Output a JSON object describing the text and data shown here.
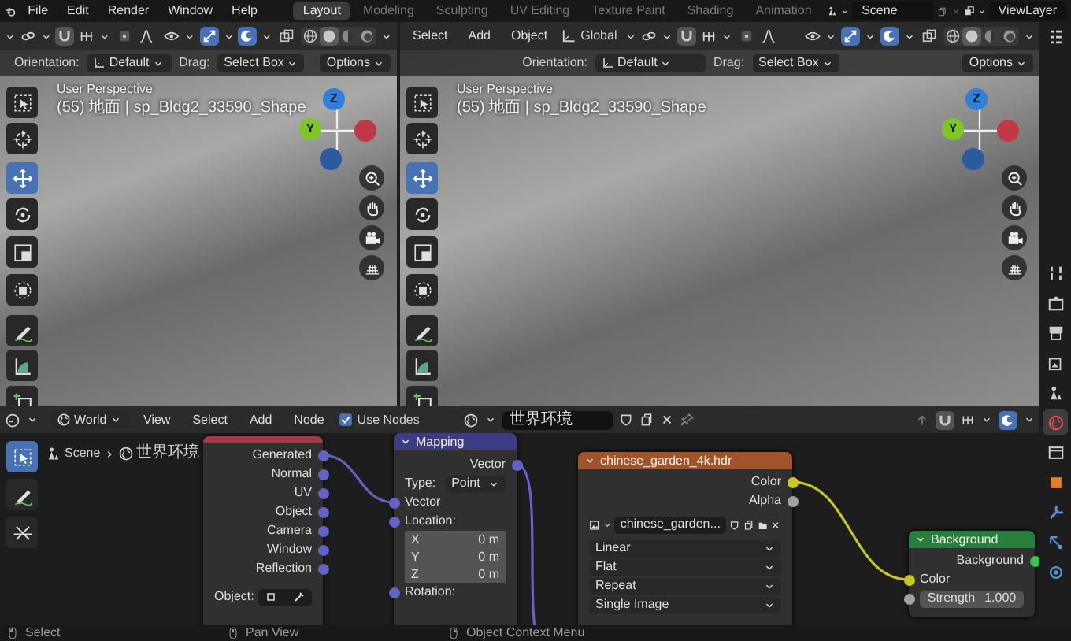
{
  "topbar": {
    "menus": [
      "File",
      "Edit",
      "Render",
      "Window",
      "Help"
    ],
    "workspaces": [
      {
        "label": "Layout",
        "selected": true
      },
      {
        "label": "Modeling",
        "selected": false
      },
      {
        "label": "Sculpting",
        "selected": false
      },
      {
        "label": "UV Editing",
        "selected": false
      },
      {
        "label": "Texture Paint",
        "selected": false
      },
      {
        "label": "Shading",
        "selected": false
      },
      {
        "label": "Animation",
        "selected": false
      }
    ],
    "scene": "Scene",
    "view_layer": "ViewLayer"
  },
  "viewports": [
    {
      "toggles": [
        {
          "kind": "snap",
          "on": false
        },
        {
          "kind": "proportional",
          "on": false
        },
        {
          "kind": "gizmo",
          "on": true
        },
        {
          "kind": "overlay",
          "on": true
        },
        {
          "kind": "xray",
          "on": false
        }
      ],
      "shading": [
        {
          "kind": "wireframe",
          "selected": false
        },
        {
          "kind": "solid",
          "selected": true
        },
        {
          "kind": "material",
          "selected": false
        },
        {
          "kind": "rendered",
          "selected": false
        }
      ],
      "tool_settings": {
        "orientation_label": "Orientation:",
        "orientation": "Default",
        "drag_label": "Drag:",
        "drag": "Select Box",
        "options": "Options"
      },
      "overlay_text": [
        "User Perspective",
        "(55) 地面 | sp_Bldg2_33590_Shape"
      ],
      "axes": [
        "Z",
        "Y"
      ],
      "tools": [
        {
          "kind": "select_box",
          "selected": false
        },
        {
          "kind": "cursor",
          "selected": false
        },
        {
          "kind": "move",
          "selected": true
        },
        {
          "kind": "rotate",
          "selected": false
        },
        {
          "kind": "scale",
          "selected": false
        },
        {
          "kind": "transform",
          "selected": false
        },
        {
          "kind": "annotate",
          "selected": false
        },
        {
          "kind": "measure",
          "selected": false
        },
        {
          "kind": "add_cube",
          "selected": false
        }
      ]
    },
    {
      "menus": [
        "Select",
        "Add",
        "Object"
      ],
      "orientation": "Global",
      "toggles": [
        {
          "kind": "snap",
          "on": false
        },
        {
          "kind": "proportional",
          "on": false
        },
        {
          "kind": "gizmo",
          "on": true
        },
        {
          "kind": "overlay",
          "on": true
        },
        {
          "kind": "xray",
          "on": false
        }
      ],
      "shading": [
        {
          "kind": "wireframe",
          "selected": false
        },
        {
          "kind": "solid",
          "selected": true
        },
        {
          "kind": "material",
          "selected": false
        },
        {
          "kind": "rendered",
          "selected": false
        }
      ],
      "tool_settings": {
        "orientation_label": "Orientation:",
        "orientation": "Default",
        "drag_label": "Drag:",
        "drag": "Select Box",
        "options": "Options"
      },
      "overlay_text": [
        "User Perspective",
        "(55) 地面 | sp_Bldg2_33590_Shape"
      ],
      "axes": [
        "Z",
        "Y"
      ],
      "tools": [
        {
          "kind": "select_box",
          "selected": false
        },
        {
          "kind": "cursor",
          "selected": false
        },
        {
          "kind": "move",
          "selected": true
        },
        {
          "kind": "rotate",
          "selected": false
        },
        {
          "kind": "scale",
          "selected": false
        },
        {
          "kind": "transform",
          "selected": false
        },
        {
          "kind": "annotate",
          "selected": false
        },
        {
          "kind": "measure",
          "selected": false
        },
        {
          "kind": "add_cube",
          "selected": false
        }
      ]
    }
  ],
  "node_editor": {
    "header": {
      "shader_type": "World",
      "menus": [
        "View",
        "Select",
        "Add",
        "Node"
      ],
      "use_nodes": {
        "label": "Use Nodes",
        "checked": true
      },
      "world": "世界环境",
      "toggles": [
        {
          "kind": "snap",
          "on": false
        },
        {
          "kind": "overlay",
          "on": true
        }
      ]
    },
    "breadcrumb": [
      "Scene",
      "世界环境"
    ],
    "tools": [
      {
        "kind": "select_box",
        "selected": true
      },
      {
        "kind": "annotate",
        "selected": false
      },
      {
        "kind": "cut_links",
        "selected": false
      }
    ],
    "nodes": [
      {
        "kind": "texture_coordinate",
        "rows": [
          {
            "kind": "output",
            "label": "Generated",
            "color": "#6363c7",
            "linked": true
          },
          {
            "kind": "output",
            "label": "Normal",
            "color": "#6363c7",
            "linked": false
          },
          {
            "kind": "output",
            "label": "UV",
            "color": "#6363c7",
            "linked": false
          },
          {
            "kind": "output",
            "label": "Object",
            "color": "#6363c7",
            "linked": false
          },
          {
            "kind": "output",
            "label": "Camera",
            "color": "#6363c7",
            "linked": false
          },
          {
            "kind": "output",
            "label": "Window",
            "color": "#6363c7",
            "linked": false
          },
          {
            "kind": "output",
            "label": "Reflection",
            "color": "#6363c7",
            "linked": false
          },
          {
            "kind": "object_field",
            "label": "Object:"
          }
        ]
      },
      {
        "kind": "mapping",
        "title": "Mapping",
        "rows": [
          {
            "kind": "output",
            "label": "Vector",
            "color": "#6363c7",
            "linked": true
          },
          {
            "kind": "dropdown",
            "label": "Type:",
            "value": "Point"
          },
          {
            "kind": "input",
            "label": "Vector",
            "color": "#6363c7",
            "linked": true
          },
          {
            "kind": "input",
            "label": "Location:",
            "color": "#6363c7",
            "linked": false
          },
          {
            "kind": "vector_field",
            "axis": "X",
            "value": "0 m"
          },
          {
            "kind": "vector_field",
            "axis": "Y",
            "value": "0 m"
          },
          {
            "kind": "vector_field",
            "axis": "Z",
            "value": "0 m"
          },
          {
            "kind": "input",
            "label": "Rotation:",
            "color": "#6363c7",
            "linked": false
          }
        ]
      },
      {
        "kind": "image_texture",
        "title": "chinese_garden_4k.hdr",
        "rows": [
          {
            "kind": "output",
            "label": "Color",
            "color": "#c7c729",
            "linked": true
          },
          {
            "kind": "output",
            "label": "Alpha",
            "color": "#a1a1a1",
            "linked": false
          },
          {
            "kind": "image_selector",
            "value": "chinese_garden..."
          },
          {
            "kind": "dropdown",
            "value": "Linear"
          },
          {
            "kind": "dropdown",
            "value": "Flat"
          },
          {
            "kind": "dropdown",
            "value": "Repeat"
          },
          {
            "kind": "dropdown",
            "value": "Single Image"
          }
        ]
      },
      {
        "kind": "background",
        "title": "Background",
        "rows": [
          {
            "kind": "output",
            "label": "Background",
            "color": "#3cc251",
            "linked": false
          },
          {
            "kind": "input",
            "label": "Color",
            "color": "#c7c729",
            "linked": true
          },
          {
            "kind": "value_field",
            "label": "Strength",
            "value": "1.000",
            "color": "#a1a1a1"
          }
        ]
      }
    ]
  },
  "properties_tabs": [
    {
      "kind": "tool",
      "selected": false
    },
    {
      "kind": "render",
      "selected": false
    },
    {
      "kind": "output",
      "selected": false
    },
    {
      "kind": "view_layer",
      "selected": false
    },
    {
      "kind": "scene",
      "selected": false
    },
    {
      "kind": "world",
      "selected": true
    },
    {
      "kind": "collection",
      "selected": false
    },
    {
      "kind": "object",
      "selected": false
    },
    {
      "kind": "modifiers",
      "selected": false
    },
    {
      "kind": "particles",
      "selected": false
    },
    {
      "kind": "physics",
      "selected": false
    }
  ],
  "status_bar": [
    {
      "kind": "mouse_left",
      "label": "Select"
    },
    {
      "kind": "mouse_middle",
      "label": "Pan View"
    },
    {
      "kind": "mouse_right",
      "label": "Object Context Menu"
    }
  ]
}
